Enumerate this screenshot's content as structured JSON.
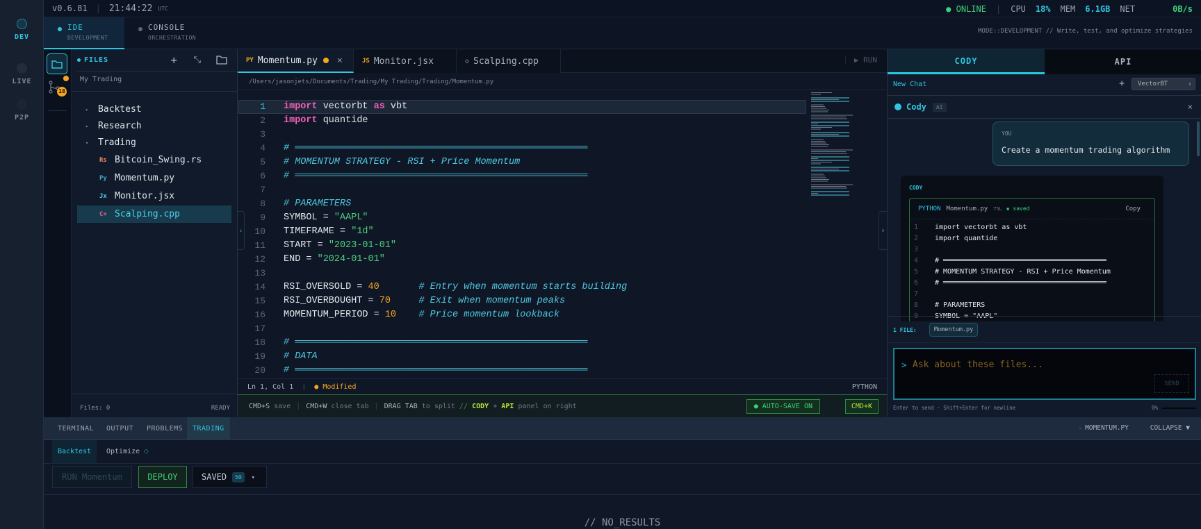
{
  "rail": {
    "items": [
      {
        "label": "DEV",
        "active": true
      },
      {
        "label": "LIVE"
      },
      {
        "label": "P2P"
      }
    ]
  },
  "topbar": {
    "version": "v0.6.81",
    "time": "21:44:22",
    "tz": "UTC",
    "status": "ONLINE",
    "cpu_label": "CPU",
    "cpu": "18%",
    "mem_label": "MEM",
    "mem": "6.1GB",
    "net_label": "NET",
    "net": "0B/s"
  },
  "modes": [
    {
      "title": "IDE",
      "sub": "DEVELOPMENT",
      "active": true
    },
    {
      "title": "CONSOLE",
      "sub": "ORCHESTRATION"
    }
  ],
  "mode_hint": "MODE::DEVELOPMENT // Write, test, and optimize strategies",
  "activity": {
    "git_badge": "18"
  },
  "files": {
    "title": "FILES",
    "root": "My Trading",
    "folders": [
      "Backtest",
      "Research",
      "Trading"
    ],
    "items": [
      {
        "icon": "Rs",
        "name": "Bitcoin_Swing.rs",
        "color": "#f08a5d"
      },
      {
        "icon": "Py",
        "name": "Momentum.py",
        "color": "#4aa3c0"
      },
      {
        "icon": "Jx",
        "name": "Monitor.jsx",
        "color": "#4fc8de"
      },
      {
        "icon": "C+",
        "name": "Scalping.cpp",
        "color": "#e0609a",
        "selected": true
      }
    ],
    "count": "Files: 0",
    "state": "READY"
  },
  "editor": {
    "tabs": [
      {
        "icon": "PY",
        "name": "Momentum.py",
        "active": true,
        "modified": true,
        "close": "×"
      },
      {
        "icon": "JS",
        "name": "Monitor.jsx"
      },
      {
        "icon": "◇",
        "name": "Scalping.cpp"
      }
    ],
    "run": "RUN",
    "path": "/Users/jasonjets/Documents/Trading/My Trading/Trading/Momentum.py",
    "lines": [
      [
        [
          "kw",
          "import"
        ],
        [
          "tx",
          " vectorbt "
        ],
        [
          "kw",
          "as"
        ],
        [
          "tx",
          " vbt"
        ]
      ],
      [
        [
          "kw",
          "import"
        ],
        [
          "tx",
          " quantide"
        ]
      ],
      [],
      [
        [
          "cm",
          "# ════════════════════════════════════════════════════"
        ]
      ],
      [
        [
          "cm",
          "# MOMENTUM STRATEGY - RSI + Price Momentum"
        ]
      ],
      [
        [
          "cm",
          "# ════════════════════════════════════════════════════"
        ]
      ],
      [],
      [
        [
          "cm",
          "# PARAMETERS"
        ]
      ],
      [
        [
          "tx",
          "SYMBOL = "
        ],
        [
          "str",
          "\"AAPL\""
        ]
      ],
      [
        [
          "tx",
          "TIMEFRAME = "
        ],
        [
          "str",
          "\"1d\""
        ]
      ],
      [
        [
          "tx",
          "START = "
        ],
        [
          "str",
          "\"2023-01-01\""
        ]
      ],
      [
        [
          "tx",
          "END = "
        ],
        [
          "str",
          "\"2024-01-01\""
        ]
      ],
      [],
      [
        [
          "tx",
          "RSI_OVERSOLD = "
        ],
        [
          "num",
          "40"
        ],
        [
          "tx",
          "       "
        ],
        [
          "cm",
          "# Entry when momentum starts building"
        ]
      ],
      [
        [
          "tx",
          "RSI_OVERBOUGHT = "
        ],
        [
          "num",
          "70"
        ],
        [
          "tx",
          "     "
        ],
        [
          "cm",
          "# Exit when momentum peaks"
        ]
      ],
      [
        [
          "tx",
          "MOMENTUM_PERIOD = "
        ],
        [
          "num",
          "10"
        ],
        [
          "tx",
          "    "
        ],
        [
          "cm",
          "# Price momentum lookback"
        ]
      ],
      [],
      [
        [
          "cm",
          "# ════════════════════════════════════════════════════"
        ]
      ],
      [
        [
          "cm",
          "# DATA"
        ]
      ],
      [
        [
          "cm",
          "# ════════════════════════════════════════════════════"
        ]
      ]
    ],
    "cursor": "Ln 1, Col 1",
    "modified": "Modified",
    "language": "PYTHON",
    "hints": [
      {
        "k": "CMD+S",
        "v": "save"
      },
      {
        "k": "CMD+W",
        "v": "close tab"
      },
      {
        "k": "DRAG TAB",
        "v": "to split"
      }
    ],
    "hint_sep": "//",
    "hint_cody": "CODY",
    "hint_plus": "+",
    "hint_api": "API",
    "hint_tail": "panel on right",
    "autosave": "AUTO-SAVE ON",
    "cmdk": "CMD+K"
  },
  "right": {
    "tabs": [
      "CODY",
      "API"
    ],
    "new_chat": "New Chat",
    "plus": "+",
    "engine": "VectorBT",
    "agent": "Cody",
    "agent_badge": "AI",
    "close": "×",
    "user_label": "YOU",
    "user_msg": "Create a momentum trading algorithm",
    "reply_label": "CODY",
    "code_lang": "PYTHON",
    "code_file": "Momentum.py",
    "code_lines": "75L",
    "code_saved": "saved",
    "copy": "Copy",
    "code": [
      "import vectorbt as vbt",
      "import quantide",
      "",
      "# ═══════════════════════════════════════",
      "# MOMENTUM STRATEGY - RSI + Price Momentum",
      "# ═══════════════════════════════════════",
      "",
      "# PARAMETERS",
      "SYMBOL = \"AAPL\""
    ],
    "files_label": "1 FILE:",
    "file_chip": "Momentum.py",
    "prompt": ">",
    "placeholder": "Ask about these files...",
    "send": "SEND",
    "footer": "Enter to send · Shift+Enter for newline",
    "progress": "0%"
  },
  "bottom": {
    "tabs": [
      "TERMINAL",
      "OUTPUT",
      "PROBLEMS",
      "TRADING"
    ],
    "active_tab": "TRADING",
    "file": "MOMENTUM.PY",
    "collapse": "COLLAPSE ▼",
    "subtabs": [
      "Backtest",
      "Optimize"
    ],
    "run": "RUN Momentum",
    "deploy": "DEPLOY",
    "saved": "SAVED",
    "saved_count": "50",
    "caret": "▾",
    "empty": "// NO_RESULTS"
  }
}
